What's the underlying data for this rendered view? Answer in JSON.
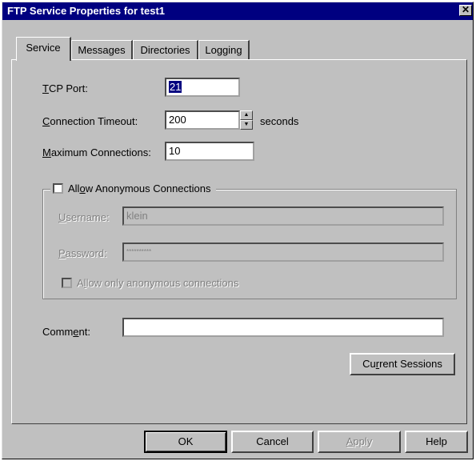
{
  "window": {
    "title": "FTP Service Properties for test1"
  },
  "tabs": [
    {
      "label": "Service"
    },
    {
      "label": "Messages"
    },
    {
      "label": "Directories"
    },
    {
      "label": "Logging"
    }
  ],
  "service": {
    "tcp_port": {
      "label_rest": "CP Port:",
      "label_key": "T",
      "value": "21"
    },
    "timeout": {
      "label_key": "C",
      "label_rest": "onnection Timeout:",
      "value": "200",
      "unit": "seconds"
    },
    "max_conn": {
      "label_key": "M",
      "label_rest": "aximum Connections:",
      "value": "10"
    },
    "anonymous": {
      "label_pre": "All",
      "label_key": "o",
      "label_post": "w Anonymous Connections",
      "checked": false,
      "username": {
        "label_key": "U",
        "label_rest": "sername:",
        "value": "klein"
      },
      "password": {
        "label_key": "P",
        "label_rest": "assword:",
        "value": "**********"
      },
      "only_anon": {
        "label_pre": "A",
        "label_key": "l",
        "label_post": "low only anonymous connections",
        "checked": false
      }
    },
    "comment": {
      "label_pre": "Comm",
      "label_key": "e",
      "label_post": "nt:",
      "value": ""
    },
    "sessions_button": {
      "label_pre": "Cu",
      "label_key": "r",
      "label_post": "rent Sessions"
    }
  },
  "buttons": {
    "ok": "OK",
    "cancel": "Cancel",
    "apply_key": "A",
    "apply_rest": "pply",
    "help": "Help"
  }
}
